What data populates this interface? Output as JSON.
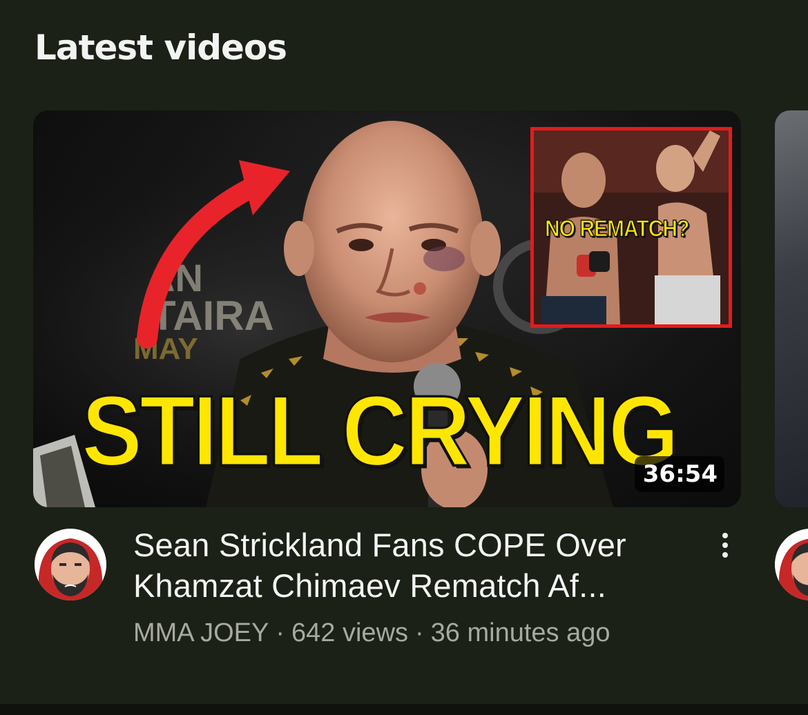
{
  "section": {
    "title": "Latest videos"
  },
  "video": {
    "thumbnail_headline": "STILL CRYING",
    "inset_caption": "NO REMATCH?",
    "duration": "36:54",
    "title_line1": "Sean Strickland Fans COPE Over",
    "title_line2": "Khamzat Chimaev Rematch Af...",
    "channel": "MMA JOEY",
    "views": "642 views",
    "age": "36 minutes ago",
    "separator": "·",
    "more_icon": "more-vert-icon"
  },
  "colors": {
    "background": "#1b2116",
    "headline_yellow": "#ffe600",
    "inset_border_red": "#e41b1b",
    "arrow_red": "#e8242a",
    "meta_gray": "#a7a9a3"
  }
}
